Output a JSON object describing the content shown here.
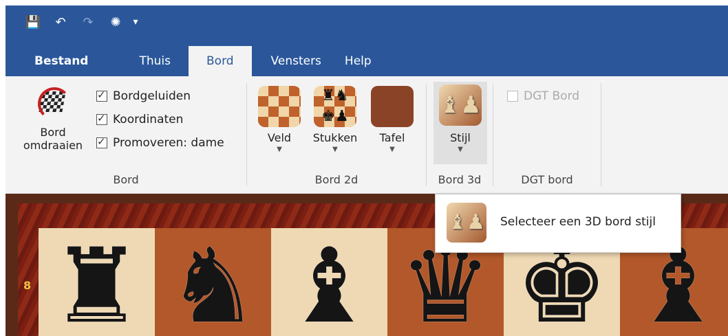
{
  "quick_access": {
    "items": [
      {
        "icon": "save-icon",
        "glyph": "💾"
      },
      {
        "icon": "undo-icon",
        "glyph": "↶"
      },
      {
        "icon": "redo-icon",
        "glyph": "↷"
      },
      {
        "icon": "engine-icon",
        "glyph": "✺"
      }
    ],
    "more_glyph": "▾"
  },
  "tabs": [
    {
      "label": "Bestand"
    },
    {
      "label": "Thuis"
    },
    {
      "label": "Bord"
    },
    {
      "label": "Vensters"
    },
    {
      "label": "Help"
    }
  ],
  "ribbon": {
    "bord_group": {
      "flip_label_1": "Bord",
      "flip_label_2": "omdraaien",
      "checks": [
        {
          "label": "Bordgeluiden",
          "checked": true
        },
        {
          "label": "Koordinaten",
          "checked": true
        },
        {
          "label": "Promoveren: dame",
          "checked": true
        }
      ],
      "group_label": "Bord"
    },
    "bord2d_group": {
      "veld_label": "Veld",
      "stukken_label": "Stukken",
      "tafel_label": "Tafel",
      "group_label": "Bord 2d"
    },
    "bord3d_group": {
      "stijl_label": "Stijl",
      "group_label": "Bord 3d"
    },
    "dgt_group": {
      "dgt_check_label": "DGT Bord",
      "group_label": "DGT bord"
    },
    "arrow_glyph": "▼",
    "check_glyph": "✓"
  },
  "board": {
    "rank_label": "8",
    "pieces": [
      "♜",
      "♞",
      "♝",
      "♛",
      "♚",
      "♝"
    ]
  },
  "tooltip": {
    "text": "Selecteer een 3D bord stijl"
  },
  "colors": {
    "accent": "#2b579a",
    "ribbon_bg": "#f3f3f3",
    "light_square": "#efd9b4",
    "dark_square": "#b3582a"
  }
}
